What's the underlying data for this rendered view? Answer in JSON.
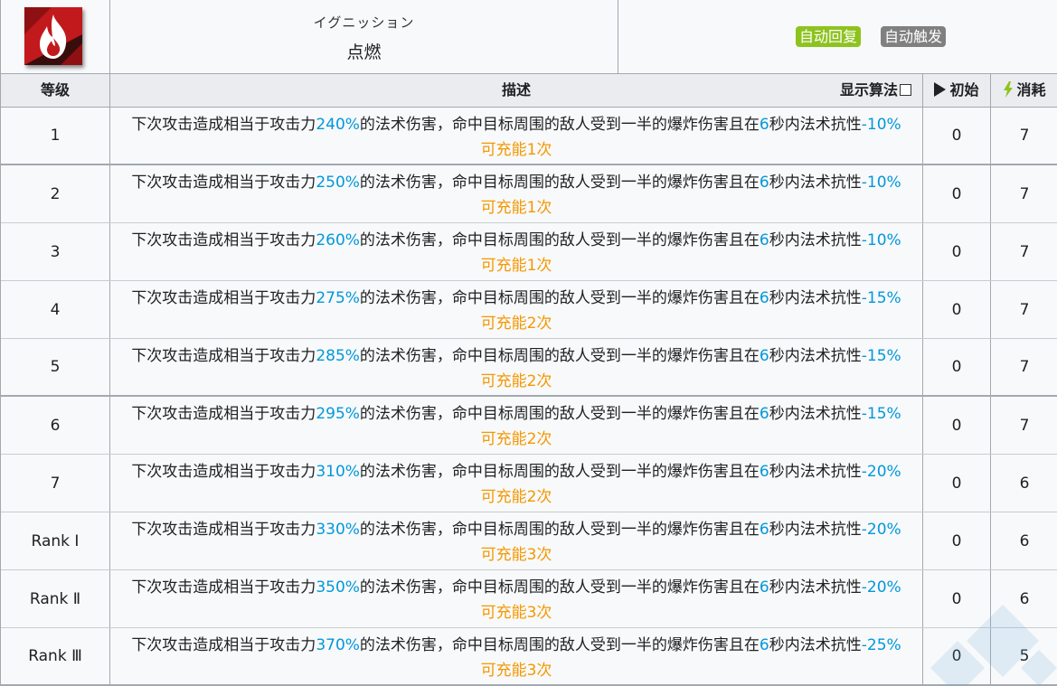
{
  "skill": {
    "name_jp": "イグニッション",
    "name_cn": "点燃",
    "tags": [
      "自动回复",
      "自动触发"
    ],
    "icon": "fire-icon"
  },
  "columns": {
    "level": "等级",
    "description": "描述",
    "show_formula": "显示算法",
    "initial": "初始",
    "cost": "消耗"
  },
  "desc_template": {
    "part1": "下次攻击造成相当于攻击力",
    "part2": "的法术伤害，命中目标周围的敌人受到一半的爆炸伤害且在",
    "duration": "6",
    "part3": "秒内法术抗性",
    "charge_prefix": "可充能",
    "charge_suffix": "次"
  },
  "rows": [
    {
      "level": "1",
      "atk": "240%",
      "res": "-10%",
      "charges": "1",
      "initial": "0",
      "cost": "7"
    },
    {
      "level": "2",
      "atk": "250%",
      "res": "-10%",
      "charges": "1",
      "initial": "0",
      "cost": "7"
    },
    {
      "level": "3",
      "atk": "260%",
      "res": "-10%",
      "charges": "1",
      "initial": "0",
      "cost": "7"
    },
    {
      "level": "4",
      "atk": "275%",
      "res": "-15%",
      "charges": "2",
      "initial": "0",
      "cost": "7"
    },
    {
      "level": "5",
      "atk": "285%",
      "res": "-15%",
      "charges": "2",
      "initial": "0",
      "cost": "7"
    },
    {
      "level": "6",
      "atk": "295%",
      "res": "-15%",
      "charges": "2",
      "initial": "0",
      "cost": "7"
    },
    {
      "level": "7",
      "atk": "310%",
      "res": "-20%",
      "charges": "2",
      "initial": "0",
      "cost": "6"
    },
    {
      "level": "Rank Ⅰ",
      "atk": "330%",
      "res": "-20%",
      "charges": "3",
      "initial": "0",
      "cost": "6"
    },
    {
      "level": "Rank Ⅱ",
      "atk": "350%",
      "res": "-20%",
      "charges": "3",
      "initial": "0",
      "cost": "6"
    },
    {
      "level": "Rank Ⅲ",
      "atk": "370%",
      "res": "-25%",
      "charges": "3",
      "initial": "0",
      "cost": "5"
    }
  ],
  "colors": {
    "value_blue": "#0098dc",
    "charge_orange": "#f49800",
    "tag_recover": "#8ec31f",
    "tag_trigger": "#808080",
    "header_bg": "#eaecf0"
  }
}
